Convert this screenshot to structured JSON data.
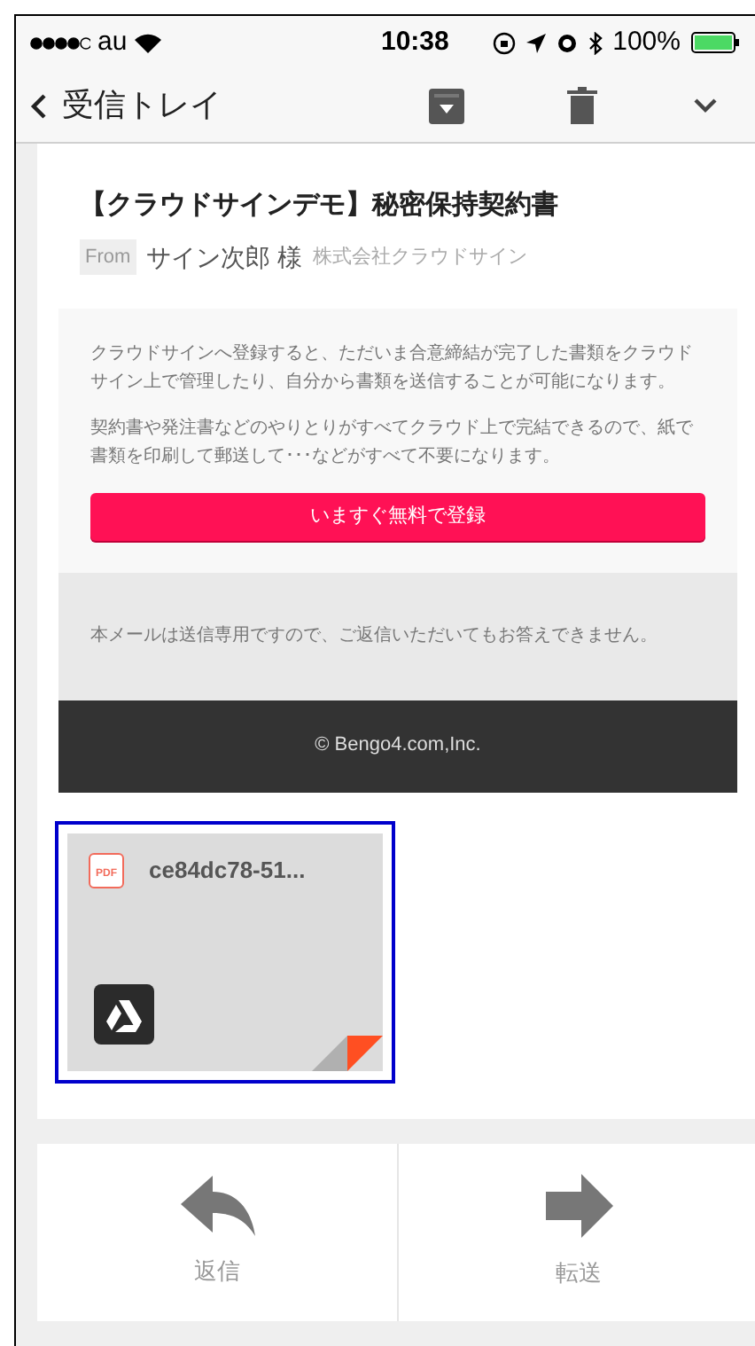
{
  "status_bar": {
    "carrier": "au",
    "time": "10:38",
    "battery": "100%"
  },
  "nav": {
    "back_label": "受信トレイ"
  },
  "email": {
    "subject": "【クラウドサインデモ】秘密保持契約書",
    "from_tag": "From",
    "sender": "サイン次郎 様",
    "company": "株式会社クラウドサイン",
    "paragraphs": [
      "クラウドサインへ登録すると、ただいま合意締結が完了した書類をクラウドサイン上で管理したり、自分から書類を送信することが可能になります。",
      "契約書や発注書などのやりとりがすべてクラウド上で完結できるので、紙で書類を印刷して郵送して･･･などがすべて不要になります。"
    ],
    "cta": "いますぐ無料で登録",
    "notice": "本メールは送信専用ですので、ご返信いただいてもお答えできません。",
    "footer": "© Bengo4.com,Inc."
  },
  "attachment": {
    "file_type": "PDF",
    "filename": "ce84dc78-51...",
    "selected": true
  },
  "actions": [
    {
      "kind": "reply",
      "label": "返信"
    },
    {
      "kind": "forward",
      "label": "転送"
    }
  ]
}
